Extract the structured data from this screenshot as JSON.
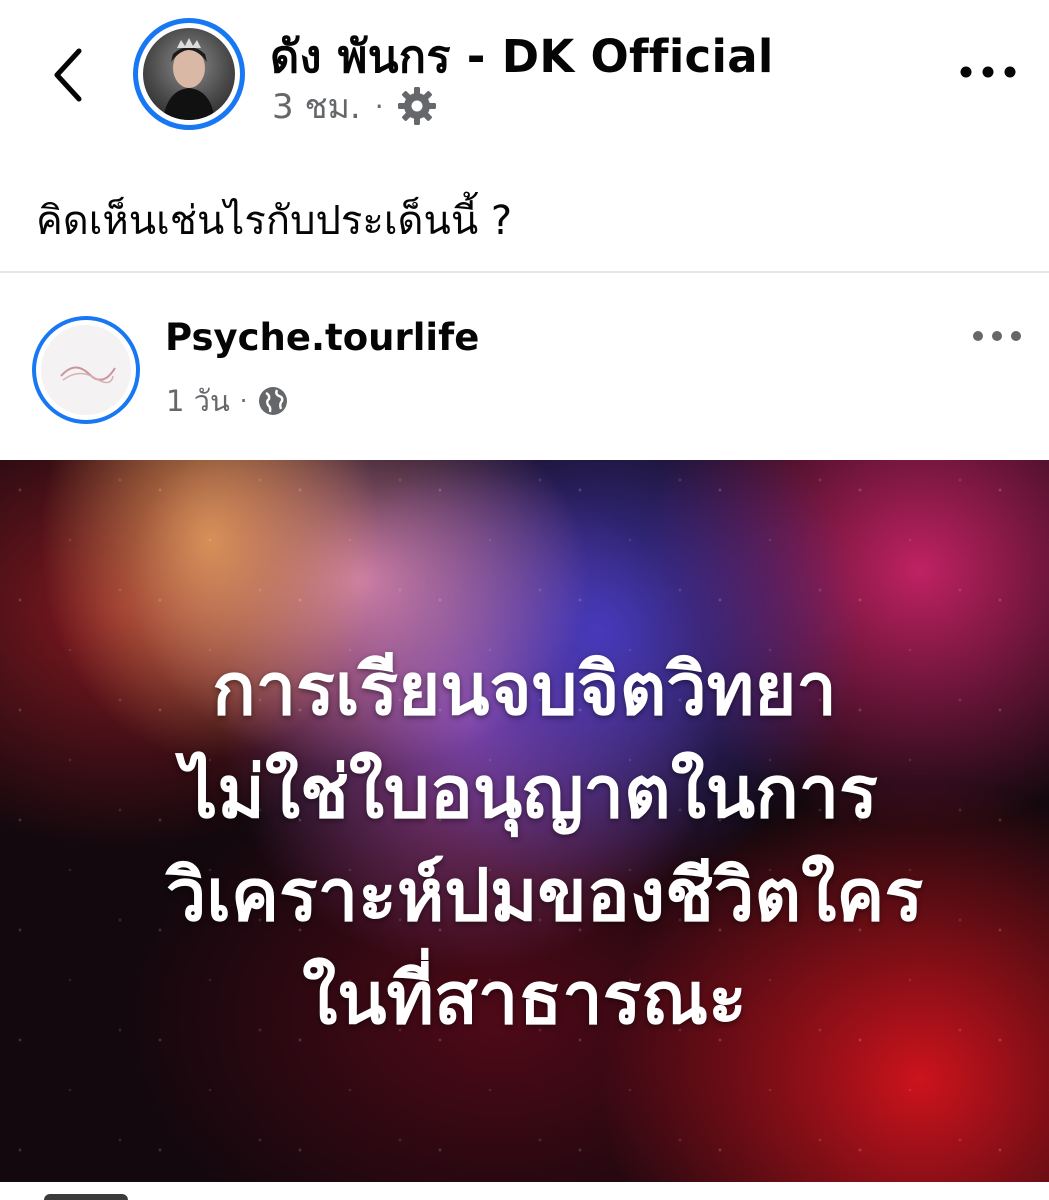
{
  "header": {
    "author_name": "ดัง พันกร - DK Official",
    "time": "3 ชม.",
    "separator": "·",
    "privacy_icon": "gear-icon",
    "back_icon": "chevron-left-icon",
    "more_icon": "more-horizontal-icon"
  },
  "post": {
    "text": "คิดเห็นเช่นไรกับประเด็นนี้ ?"
  },
  "shared": {
    "page_name": "Psyche.tourlife",
    "time": "1 วัน",
    "separator": "·",
    "privacy_icon": "globe-icon",
    "more_icon": "more-horizontal-icon",
    "image_lines": [
      "การเรียนจบจิตวิทยา",
      "ไม่ใช่ใบอนุญาตในการ",
      "วิเคราะห์ปมของชีวิตใคร",
      "ในที่สาธารณะ"
    ]
  },
  "colors": {
    "accent": "#1877f2",
    "secondary_text": "#65676b",
    "divider": "#e4e6eb"
  }
}
